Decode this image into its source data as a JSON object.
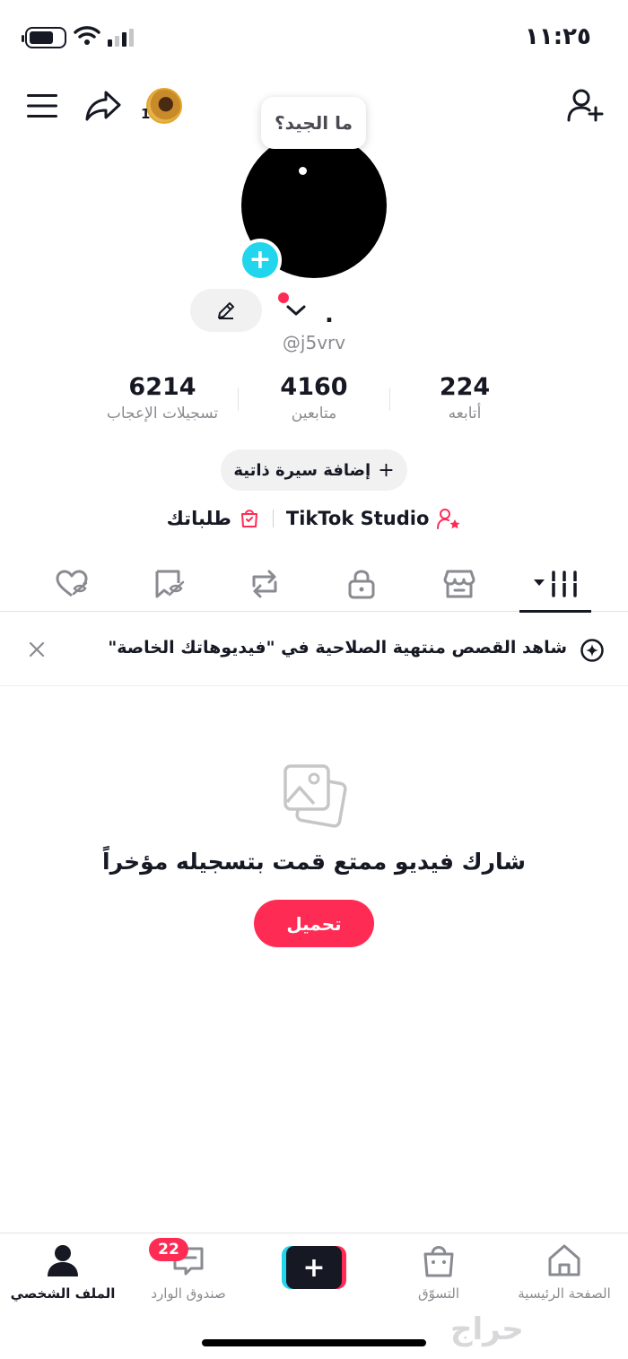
{
  "status_bar": {
    "time": "١١:٢٥"
  },
  "header": {
    "avatar_count": "1",
    "tooltip": "ما الجيد؟"
  },
  "profile": {
    "display_name": ".",
    "handle": "@j5vrv"
  },
  "stats": [
    {
      "value": "224",
      "label": "أتابعه"
    },
    {
      "value": "4160",
      "label": "متابعين"
    },
    {
      "value": "6214",
      "label": "تسجيلات الإعجاب"
    }
  ],
  "bio_button": {
    "label": "إضافة سيرة ذاتية",
    "icon": "+"
  },
  "links": {
    "studio": "TikTok Studio",
    "orders": "طلباتك"
  },
  "tabs": [
    "videos-grid",
    "shop",
    "private",
    "reposts",
    "favorites",
    "liked"
  ],
  "banner": {
    "text": "شاهد القصص منتهية الصلاحية في \"فيديوهاتك الخاصة\""
  },
  "empty_state": {
    "title": "شارك فيديو ممتع قمت بتسجيله مؤخراً",
    "button": "تحميل"
  },
  "bottom_nav": {
    "home": "الصفحة الرئيسية",
    "shop": "التسوّق",
    "inbox": "صندوق الوارد",
    "inbox_badge": "22",
    "profile": "الملف الشخصي"
  },
  "watermark": "حراج",
  "colors": {
    "accent": "#fe2c55",
    "cyan": "#20d5ec",
    "text": "#161823",
    "muted": "#8a8b91"
  }
}
